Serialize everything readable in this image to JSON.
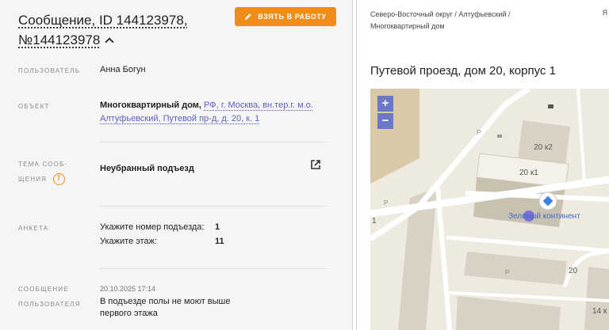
{
  "message": {
    "title_line1": "Сообщение, ID 144123978,",
    "title_line2": "№144123978",
    "take_button": "ВЗЯТЬ В РАБОТУ"
  },
  "fields": {
    "user_label": "ПОЛЬЗОВАТЕЛЬ",
    "user_value": "Анна Богун",
    "object_label": "ОБЪЕКТ",
    "object_type": "Многоквартирный дом,",
    "object_address": "РФ, г. Москва, вн.тер.г. м.о. Алтуфьевский, Путевой пр-д, д. 20, к. 1",
    "topic_label_line1": "ТЕМА СООБ-",
    "topic_label_line2": "ЩЕНИЯ",
    "topic_warn": "!",
    "topic_value": "Неубранный подъезд",
    "survey_label": "АНКЕТА",
    "survey": [
      {
        "q": "Укажите номер подъезда:",
        "a": "1"
      },
      {
        "q": "Укажите этаж:",
        "a": "11"
      }
    ],
    "user_message_label_line1": "СООБЩЕНИЕ",
    "user_message_label_line2": "ПОЛЬЗОВАТЕЛЯ",
    "user_message_date": "20.10.2025 17:14",
    "user_message_text": "В подъезде полы не моют выше первого этажа"
  },
  "right_panel": {
    "breadcrumb": "Северо-Восточный округ / Алтуфьевский / Многоквартирный дом",
    "corner_text": "Я",
    "address": "Путевой проезд, дом 20, корпус 1"
  },
  "map": {
    "zoom_in": "+",
    "zoom_out": "−",
    "labels": {
      "b1": "20 к2",
      "b2": "20 к1",
      "poi": "Зеленый континент",
      "b3": "20",
      "b4": "14 к",
      "p1": "P",
      "p2": "P",
      "p3": "P",
      "edge1": "1"
    },
    "colors": {
      "building": "#d8d2c4",
      "building_dark": "#c9c1b0",
      "road": "#ffffff",
      "poi_marker": "#7c6fd6",
      "pin": "#3b82e6"
    }
  }
}
